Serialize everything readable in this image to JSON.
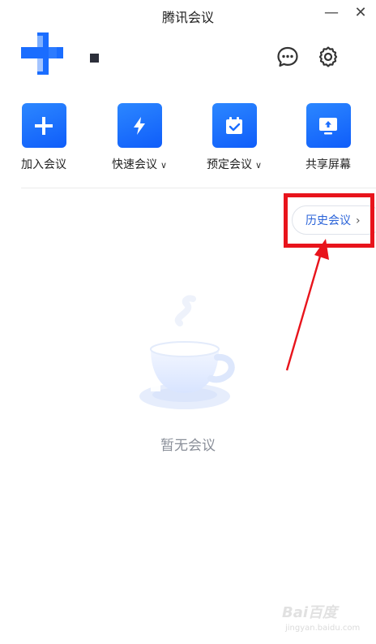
{
  "window": {
    "title": "腾讯会议",
    "minimize_glyph": "—",
    "close_glyph": "✕"
  },
  "header": {
    "avatar_icon": "avatar-icon",
    "chat_icon": "chat-bubble-icon",
    "settings_icon": "gear-icon"
  },
  "actions": [
    {
      "label": "加入会议",
      "icon": "plus-icon",
      "has_dropdown": false
    },
    {
      "label": "快速会议",
      "icon": "lightning-icon",
      "has_dropdown": true
    },
    {
      "label": "预定会议",
      "icon": "calendar-check-icon",
      "has_dropdown": true
    },
    {
      "label": "共享屏幕",
      "icon": "screen-share-icon",
      "has_dropdown": false
    }
  ],
  "history": {
    "label": "历史会议",
    "chevron": "›"
  },
  "empty_state": {
    "text": "暂无会议",
    "icon": "coffee-cup-icon"
  },
  "chevron_down": "∨",
  "watermark": {
    "brand": "Bai百度",
    "sub": "jingyan.baidu.com"
  },
  "colors": {
    "accent": "#1a6dff",
    "highlight_box": "#e8141c",
    "arrow": "#e8141c"
  }
}
